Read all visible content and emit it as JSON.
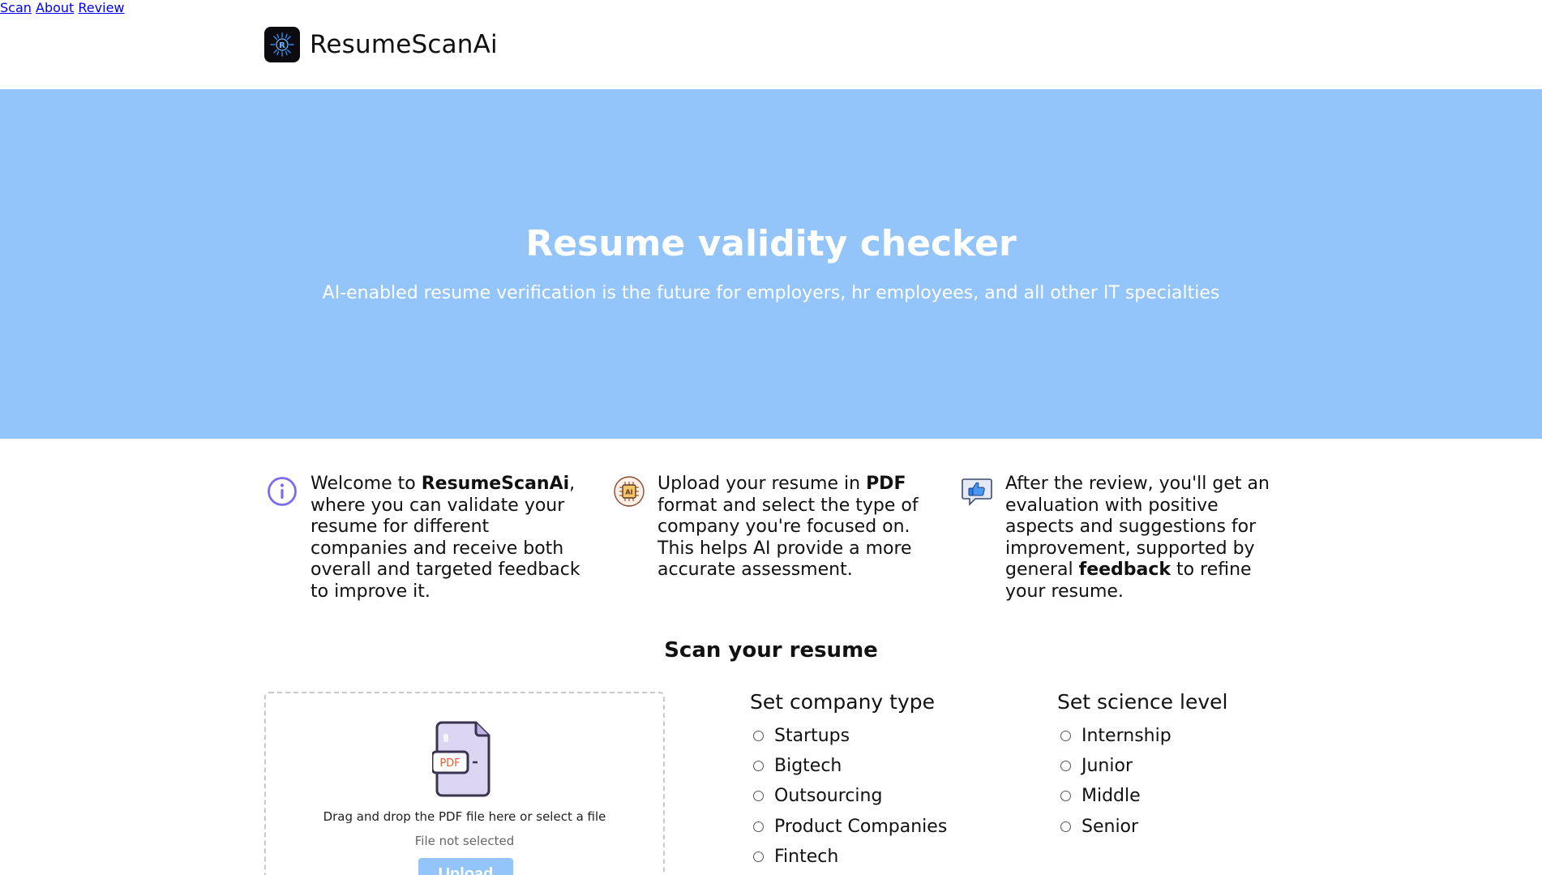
{
  "header": {
    "brand": "ResumeScanAi",
    "logo_icon": "resumescanai-logo-icon",
    "nav": [
      "Scan",
      "About",
      "Review"
    ]
  },
  "hero": {
    "title": "Resume validity checker",
    "subtitle": "AI-enabled resume verification is the future for employers, hr employees, and all other IT specialties",
    "background": "#93c5fb"
  },
  "features": [
    {
      "icon": "info-icon",
      "pre": "Welcome to ",
      "bold": "ResumeScanAi",
      "post": ", where you can validate your resume for different companies and receive both overall and targeted feedback to improve it."
    },
    {
      "icon": "ai-chip-icon",
      "pre": "Upload your resume in ",
      "bold": "PDF",
      "post": " format and select the type of company you're focused on. This helps AI provide a more accurate assessment."
    },
    {
      "icon": "thumbs-up-chat-icon",
      "pre": "After the review, you'll get an evaluation with positive aspects and suggestions for improvement, supported by general ",
      "bold": "feedback",
      "post": " to refine your resume."
    }
  ],
  "scan": {
    "title": "Scan your resume",
    "upload": {
      "icon": "pdf-file-icon",
      "icon_label": "PDF",
      "drag_text": "Drag and drop the PDF file here or select a file",
      "file_status": "File not selected",
      "button_label": "Upload"
    },
    "company_type": {
      "title": "Set company type",
      "options": [
        "Startups",
        "Bigtech",
        "Outsourcing",
        "Product Companies",
        "Fintech"
      ]
    },
    "science_level": {
      "title": "Set science level",
      "options": [
        "Internship",
        "Junior",
        "Middle",
        "Senior"
      ]
    }
  }
}
